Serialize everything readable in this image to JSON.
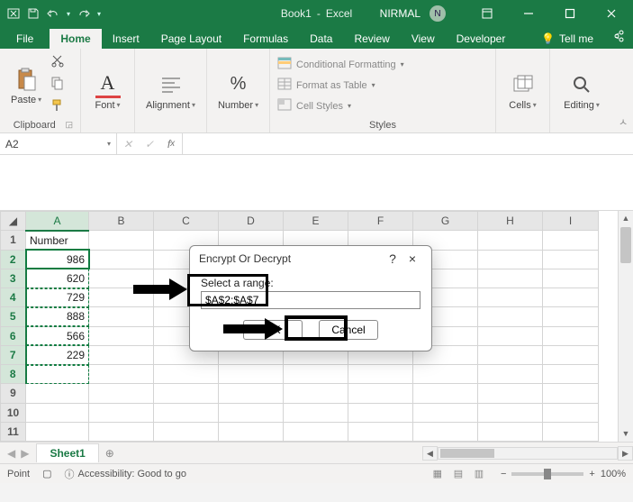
{
  "titlebar": {
    "doc": "Book1",
    "app": "Excel",
    "user": "NIRMAL",
    "avatar_initial": "N"
  },
  "tabs": {
    "file": "File",
    "home": "Home",
    "insert": "Insert",
    "page_layout": "Page Layout",
    "formulas": "Formulas",
    "data": "Data",
    "review": "Review",
    "view": "View",
    "developer": "Developer",
    "tell_me": "Tell me"
  },
  "ribbon": {
    "clipboard": {
      "label": "Clipboard",
      "paste": "Paste"
    },
    "font": {
      "label": "Font"
    },
    "alignment": {
      "label": "Alignment"
    },
    "number": {
      "label": "Number"
    },
    "styles": {
      "label": "Styles",
      "cond_fmt": "Conditional Formatting",
      "fmt_table": "Format as Table",
      "cell_styles": "Cell Styles"
    },
    "cells": {
      "label": "Cells"
    },
    "editing": {
      "label": "Editing"
    }
  },
  "namebox": {
    "ref": "A2"
  },
  "grid": {
    "columns": [
      "A",
      "B",
      "C",
      "D",
      "E",
      "F",
      "G",
      "H",
      "I"
    ],
    "rows": [
      "1",
      "2",
      "3",
      "4",
      "5",
      "6",
      "7",
      "8",
      "9",
      "10",
      "11"
    ],
    "header_cell": "Number",
    "values": [
      "986",
      "620",
      "729",
      "888",
      "566",
      "229"
    ]
  },
  "dialog": {
    "title": "Encrypt Or Decrypt",
    "help": "?",
    "close": "×",
    "prompt": "Select a range:",
    "value": "$A$2:$A$7",
    "ok": "OK",
    "cancel": "Cancel"
  },
  "sheets": {
    "active": "Sheet1",
    "add": "⊕"
  },
  "status": {
    "mode": "Point",
    "accessibility": "Accessibility: Good to go",
    "zoom": "100%"
  }
}
